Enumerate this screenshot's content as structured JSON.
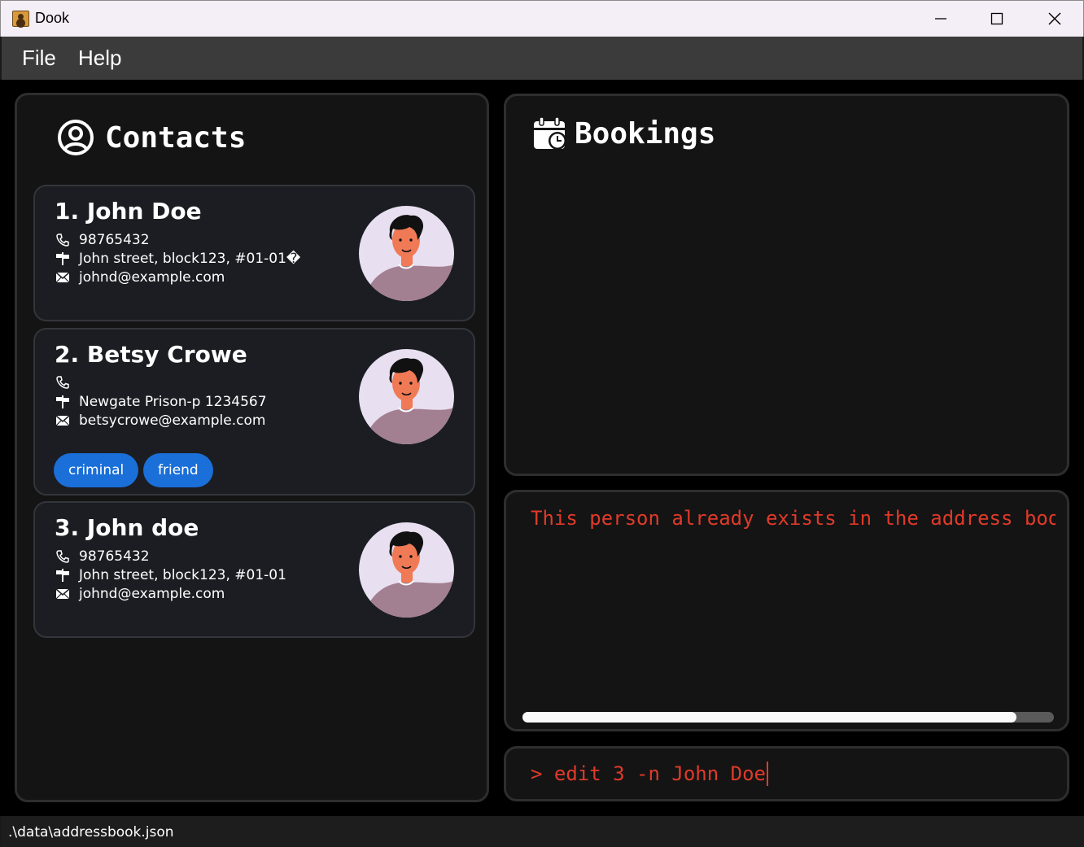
{
  "window": {
    "title": "Dook",
    "app_icon": "address-book-icon",
    "controls": [
      "minimize-icon",
      "maximize-icon",
      "close-icon"
    ]
  },
  "menu": {
    "items": [
      {
        "label": "File"
      },
      {
        "label": "Help"
      }
    ]
  },
  "contacts": {
    "title": "Contacts",
    "icon": "user-circle-icon",
    "cards": [
      {
        "index_name": "1. John Doe",
        "phone": "98765432",
        "address": "John street, block123, #01-01�",
        "email": "johnd@example.com",
        "tags": []
      },
      {
        "index_name": "2. Betsy Crowe",
        "phone": "",
        "address": "Newgate Prison-p 1234567",
        "email": "betsycrowe@example.com",
        "tags": [
          "criminal",
          "friend"
        ]
      },
      {
        "index_name": "3. John doe",
        "phone": "98765432",
        "address": "John street, block123, #01-01",
        "email": "johnd@example.com",
        "tags": []
      }
    ]
  },
  "bookings": {
    "title": "Bookings",
    "icon": "calendar-clock-icon"
  },
  "result": {
    "message": "This person already exists in the address book",
    "scroll_fraction": 0.93
  },
  "command": {
    "value": "> edit 3 -n John Doe"
  },
  "status": {
    "path": ".\\data\\addressbook.json"
  },
  "colors": {
    "error_text": "#e03a2a",
    "tag_bg": "#1a6fd8",
    "panel_bg": "#141414",
    "card_bg": "#1b1d22"
  }
}
